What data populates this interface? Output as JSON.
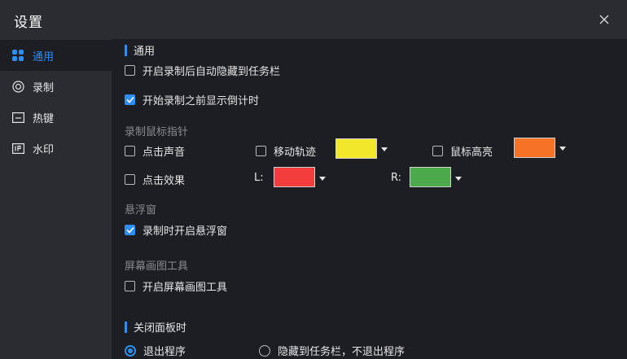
{
  "window": {
    "title": "设置"
  },
  "sidebar": {
    "items": [
      {
        "label": "通用",
        "icon": "grid-icon",
        "active": true
      },
      {
        "label": "录制",
        "icon": "record-icon"
      },
      {
        "label": "热键",
        "icon": "keyboard-icon"
      },
      {
        "label": "水印",
        "icon": "watermark-icon"
      }
    ]
  },
  "general": {
    "heading": "通用",
    "auto_hide_label": "开启录制后自动隐藏到任务栏",
    "auto_hide_checked": false,
    "countdown_label": "开始录制之前显示倒计时",
    "countdown_checked": true
  },
  "cursor": {
    "heading": "录制鼠标指针",
    "click_sound_label": "点击声音",
    "move_track_label": "移动轨迹",
    "move_track_color": "#f2e72a",
    "highlight_label": "鼠标高亮",
    "highlight_color": "#f57227",
    "click_effect_label": "点击效果",
    "left_label": "L:",
    "left_color": "#f33d3d",
    "right_label": "R:",
    "right_color": "#4caa4c"
  },
  "floating": {
    "heading": "悬浮窗",
    "open_label": "录制时开启悬浮窗",
    "open_checked": true
  },
  "drawing": {
    "heading": "屏幕画图工具",
    "open_label": "开启屏幕画图工具",
    "open_checked": false
  },
  "close_panel": {
    "heading": "关闭面板时",
    "exit_label": "退出程序",
    "hide_label": "隐藏到任务栏，不退出程序",
    "selected": "exit"
  },
  "colors": {
    "accent": "#2f8ff0",
    "background": "#1d1e23",
    "sidebar": "#2b2c31"
  }
}
